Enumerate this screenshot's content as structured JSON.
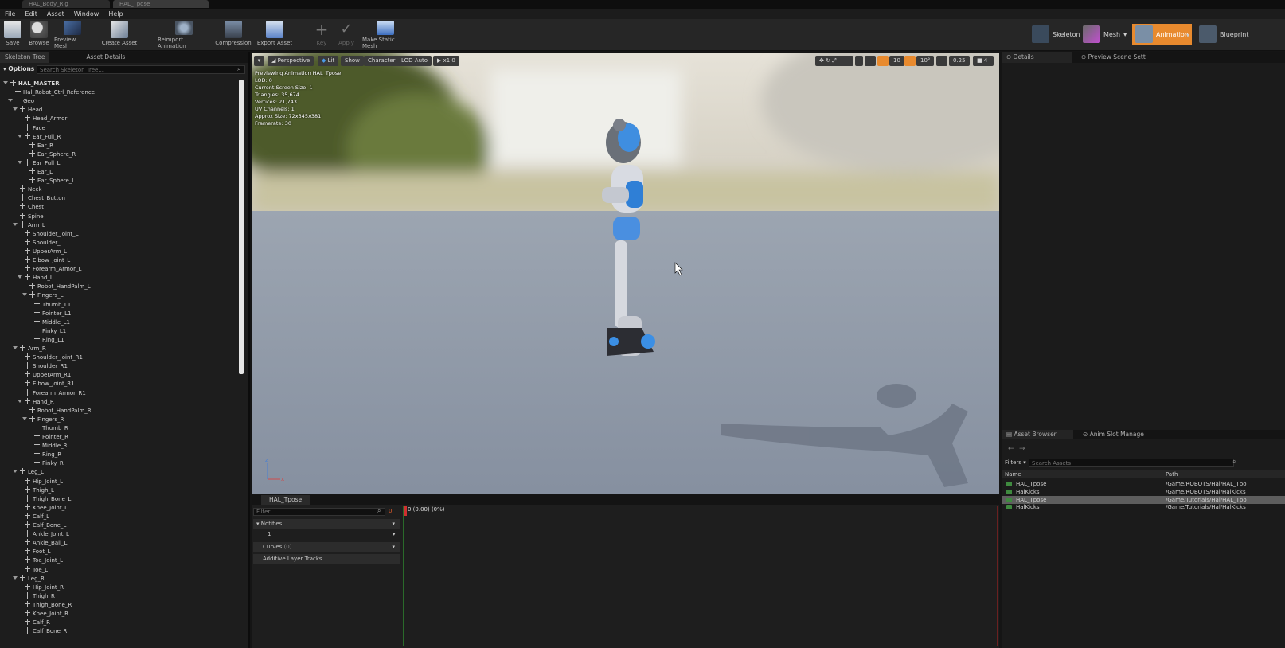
{
  "window": {
    "tabs": [
      "HAL_Body_Rig",
      "HAL_Tpose"
    ]
  },
  "menu": [
    "File",
    "Edit",
    "Asset",
    "Window",
    "Help"
  ],
  "toolbar": {
    "buttons": [
      "Save",
      "Browse",
      "Preview Mesh",
      "Create Asset",
      "Reimport Animation",
      "Compression",
      "Export Asset",
      "Key",
      "Apply",
      "Make Static Mesh"
    ],
    "modes": [
      "Skeleton",
      "Mesh",
      "Animation",
      "Blueprint"
    ]
  },
  "left": {
    "tabs": [
      "Skeleton Tree",
      "Asset Details"
    ],
    "options_label": "Options",
    "search_placeholder": "Search Skeleton Tree...",
    "tree": [
      {
        "d": 0,
        "t": "HAL_MASTER",
        "exp": true,
        "bold": true
      },
      {
        "d": 1,
        "t": "Hal_Robot_Ctrl_Reference"
      },
      {
        "d": 1,
        "t": "Geo",
        "exp": true
      },
      {
        "d": 2,
        "t": "Head",
        "exp": true
      },
      {
        "d": 3,
        "t": "Head_Armor"
      },
      {
        "d": 3,
        "t": "Face"
      },
      {
        "d": 3,
        "t": "Ear_Full_R",
        "exp": true
      },
      {
        "d": 4,
        "t": "Ear_R"
      },
      {
        "d": 4,
        "t": "Ear_Sphere_R"
      },
      {
        "d": 3,
        "t": "Ear_Full_L",
        "exp": true
      },
      {
        "d": 4,
        "t": "Ear_L"
      },
      {
        "d": 4,
        "t": "Ear_Sphere_L"
      },
      {
        "d": 2,
        "t": "Neck"
      },
      {
        "d": 2,
        "t": "Chest_Button"
      },
      {
        "d": 2,
        "t": "Chest"
      },
      {
        "d": 2,
        "t": "Spine"
      },
      {
        "d": 2,
        "t": "Arm_L",
        "exp": true
      },
      {
        "d": 3,
        "t": "Shoulder_Joint_L"
      },
      {
        "d": 3,
        "t": "Shoulder_L"
      },
      {
        "d": 3,
        "t": "UpperArm_L"
      },
      {
        "d": 3,
        "t": "Elbow_Joint_L"
      },
      {
        "d": 3,
        "t": "Forearm_Armor_L"
      },
      {
        "d": 3,
        "t": "Hand_L",
        "exp": true
      },
      {
        "d": 4,
        "t": "Robot_HandPalm_L"
      },
      {
        "d": 4,
        "t": "Fingers_L",
        "exp": true
      },
      {
        "d": 5,
        "t": "Thumb_L1"
      },
      {
        "d": 5,
        "t": "Pointer_L1"
      },
      {
        "d": 5,
        "t": "Middle_L1"
      },
      {
        "d": 5,
        "t": "Pinky_L1"
      },
      {
        "d": 5,
        "t": "Ring_L1"
      },
      {
        "d": 2,
        "t": "Arm_R",
        "exp": true
      },
      {
        "d": 3,
        "t": "Shoulder_Joint_R1"
      },
      {
        "d": 3,
        "t": "Shoulder_R1"
      },
      {
        "d": 3,
        "t": "UpperArm_R1"
      },
      {
        "d": 3,
        "t": "Elbow_Joint_R1"
      },
      {
        "d": 3,
        "t": "Forearm_Armor_R1"
      },
      {
        "d": 3,
        "t": "Hand_R",
        "exp": true
      },
      {
        "d": 4,
        "t": "Robot_HandPalm_R"
      },
      {
        "d": 4,
        "t": "Fingers_R",
        "exp": true
      },
      {
        "d": 5,
        "t": "Thumb_R"
      },
      {
        "d": 5,
        "t": "Pointer_R"
      },
      {
        "d": 5,
        "t": "Middle_R"
      },
      {
        "d": 5,
        "t": "Ring_R"
      },
      {
        "d": 5,
        "t": "Pinky_R"
      },
      {
        "d": 2,
        "t": "Leg_L",
        "exp": true
      },
      {
        "d": 3,
        "t": "Hip_Joint_L"
      },
      {
        "d": 3,
        "t": "Thigh_L"
      },
      {
        "d": 3,
        "t": "Thigh_Bone_L"
      },
      {
        "d": 3,
        "t": "Knee_Joint_L"
      },
      {
        "d": 3,
        "t": "Calf_L"
      },
      {
        "d": 3,
        "t": "Calf_Bone_L"
      },
      {
        "d": 3,
        "t": "Ankle_Joint_L"
      },
      {
        "d": 3,
        "t": "Ankle_Ball_L"
      },
      {
        "d": 3,
        "t": "Foot_L"
      },
      {
        "d": 3,
        "t": "Toe_Joint_L"
      },
      {
        "d": 3,
        "t": "Toe_L"
      },
      {
        "d": 2,
        "t": "Leg_R",
        "exp": true
      },
      {
        "d": 3,
        "t": "Hip_Joint_R"
      },
      {
        "d": 3,
        "t": "Thigh_R"
      },
      {
        "d": 3,
        "t": "Thigh_Bone_R"
      },
      {
        "d": 3,
        "t": "Knee_Joint_R"
      },
      {
        "d": 3,
        "t": "Calf_R"
      },
      {
        "d": 3,
        "t": "Calf_Bone_R"
      }
    ]
  },
  "viewport": {
    "buttons": [
      "Perspective",
      "Lit",
      "Show",
      "Character",
      "LOD Auto",
      "x1.0"
    ],
    "right_values": [
      "10",
      "10°",
      "0.25"
    ],
    "info": [
      "Previewing Animation HAL_Tpose",
      "LOD: 0",
      "Current Screen Size: 1",
      "Triangles: 35,674",
      "Vertices: 21,743",
      "UV Channels: 1",
      "Approx Size: 72x345x381",
      "Framerate: 30"
    ]
  },
  "timeline": {
    "tab": "HAL_Tpose",
    "filter_placeholder": "Filter",
    "zero": "0",
    "frame_readout": "0 (0.00) (0%)",
    "notifies": "Notifies",
    "notify_track": "1",
    "curves": "Curves",
    "curves_count": "(0)",
    "additive": "Additive Layer Tracks"
  },
  "right": {
    "tabs": [
      "Details",
      "Preview Scene Sett"
    ],
    "bottom_tabs": [
      "Asset Browser",
      "Anim Slot Manage"
    ],
    "filters": "Filters",
    "search_placeholder": "Search Assets",
    "columns": [
      "Name",
      "Path"
    ],
    "assets": [
      {
        "name": "HAL_Tpose",
        "path": "/Game/ROBOTS/Hal/HAL_Tpo"
      },
      {
        "name": "HalKicks",
        "path": "/Game/ROBOTS/Hal/HalKicks"
      },
      {
        "name": "HAL_Tpose",
        "path": "/Game/Tutorials/Hal/HAL_Tpo",
        "selected": true
      },
      {
        "name": "HalKicks",
        "path": "/Game/Tutorials/Hal/HalKicks"
      }
    ]
  },
  "colors": {
    "accent": "#e88a2e",
    "blue": "#3a8fd8"
  }
}
